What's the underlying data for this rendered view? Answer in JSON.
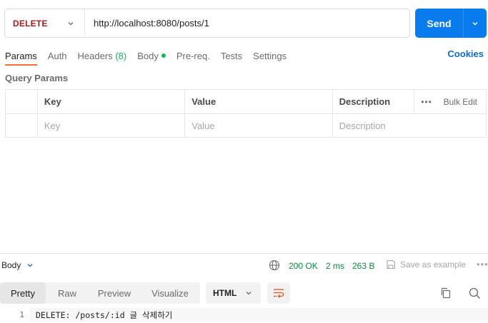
{
  "request": {
    "method": "DELETE",
    "url": "http://localhost:8080/posts/1",
    "send_label": "Send"
  },
  "tabs": [
    {
      "label": "Params",
      "active": true
    },
    {
      "label": "Auth"
    },
    {
      "label": "Headers",
      "count": "(8)"
    },
    {
      "label": "Body",
      "dot": true
    },
    {
      "label": "Pre-req."
    },
    {
      "label": "Tests"
    },
    {
      "label": "Settings"
    }
  ],
  "cookies_label": "Cookies",
  "query_params": {
    "title": "Query Params",
    "columns": {
      "key": "Key",
      "value": "Value",
      "description": "Description"
    },
    "bulk_edit": "Bulk Edit",
    "placeholders": {
      "key": "Key",
      "value": "Value",
      "description": "Description"
    }
  },
  "response": {
    "body_label": "Body",
    "status": "200 OK",
    "time": "2 ms",
    "size": "263 B",
    "save_example": "Save as example",
    "views": [
      "Pretty",
      "Raw",
      "Preview",
      "Visualize"
    ],
    "active_view": "Pretty",
    "format": "HTML",
    "lines": [
      {
        "no": "1",
        "text": "DELETE: /posts/:id 글 삭제하기"
      }
    ]
  },
  "colors": {
    "accent": "#097bed",
    "method_delete": "#a11c1c",
    "status_ok": "#0a8a3c",
    "active_tab_underline": "#ff6c37"
  }
}
